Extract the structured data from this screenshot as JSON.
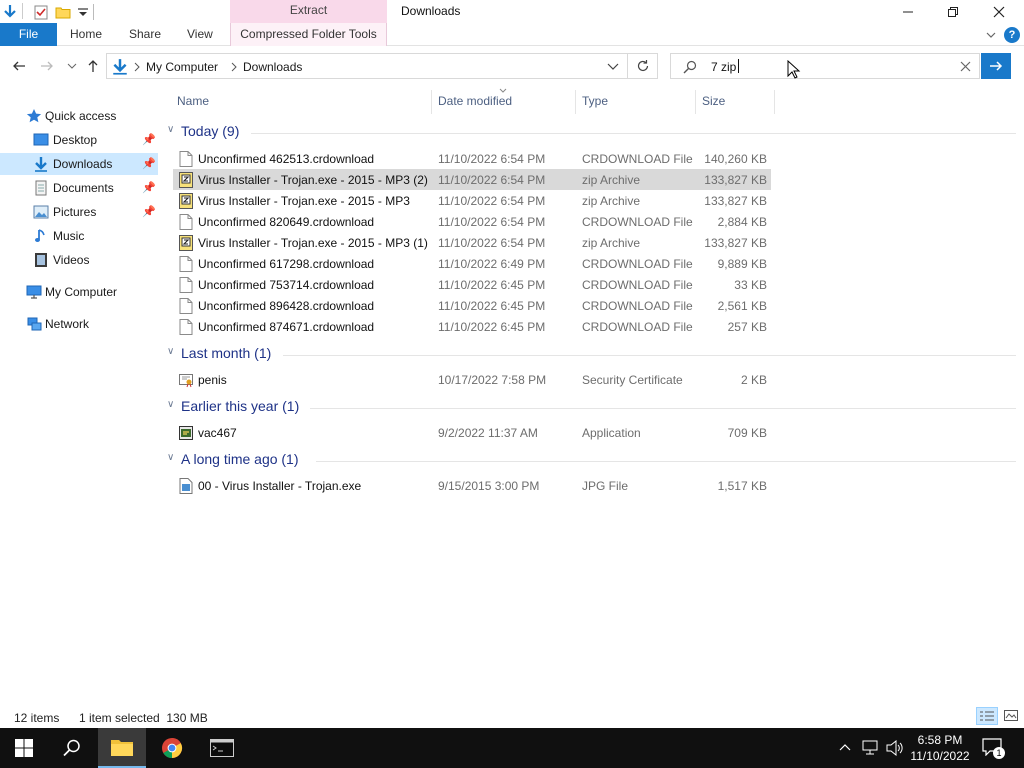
{
  "window": {
    "title": "Downloads",
    "contextual_group": "Extract"
  },
  "ribbon": {
    "tabs": [
      "File",
      "Home",
      "Share",
      "View",
      "Compressed Folder Tools"
    ]
  },
  "address": {
    "breadcrumb": [
      "My Computer",
      "Downloads"
    ]
  },
  "search": {
    "value": "7 zip"
  },
  "nav_pane": {
    "items": [
      {
        "label": "Quick access",
        "icon": "star-icon"
      },
      {
        "label": "Desktop",
        "icon": "desktop-icon"
      },
      {
        "label": "Downloads",
        "icon": "download-arrow-icon"
      },
      {
        "label": "Documents",
        "icon": "documents-icon"
      },
      {
        "label": "Pictures",
        "icon": "pictures-icon"
      },
      {
        "label": "Music",
        "icon": "music-note-icon"
      },
      {
        "label": "Videos",
        "icon": "video-icon"
      },
      {
        "label": "My Computer",
        "icon": "computer-icon"
      },
      {
        "label": "Network",
        "icon": "network-icon"
      }
    ]
  },
  "columns": {
    "name": "Name",
    "date": "Date modified",
    "type": "Type",
    "size": "Size"
  },
  "groups": [
    {
      "title": "Today (9)",
      "files": [
        {
          "name": "Unconfirmed 462513.crdownload",
          "date": "11/10/2022 6:54 PM",
          "type": "CRDOWNLOAD File",
          "size": "140,260 KB",
          "icon": "blank-file-icon"
        },
        {
          "name": "Virus Installer - Trojan.exe - 2015 - MP3 (2)",
          "date": "11/10/2022 6:54 PM",
          "type": "zip Archive",
          "size": "133,827 KB",
          "icon": "zip-archive-icon"
        },
        {
          "name": "Virus Installer - Trojan.exe - 2015 - MP3",
          "date": "11/10/2022 6:54 PM",
          "type": "zip Archive",
          "size": "133,827 KB",
          "icon": "zip-archive-icon"
        },
        {
          "name": "Unconfirmed 820649.crdownload",
          "date": "11/10/2022 6:54 PM",
          "type": "CRDOWNLOAD File",
          "size": "2,884 KB",
          "icon": "blank-file-icon"
        },
        {
          "name": "Virus Installer - Trojan.exe - 2015 - MP3 (1)",
          "date": "11/10/2022 6:54 PM",
          "type": "zip Archive",
          "size": "133,827 KB",
          "icon": "zip-archive-icon"
        },
        {
          "name": "Unconfirmed 617298.crdownload",
          "date": "11/10/2022 6:49 PM",
          "type": "CRDOWNLOAD File",
          "size": "9,889 KB",
          "icon": "blank-file-icon"
        },
        {
          "name": "Unconfirmed 753714.crdownload",
          "date": "11/10/2022 6:45 PM",
          "type": "CRDOWNLOAD File",
          "size": "33 KB",
          "icon": "blank-file-icon"
        },
        {
          "name": "Unconfirmed 896428.crdownload",
          "date": "11/10/2022 6:45 PM",
          "type": "CRDOWNLOAD File",
          "size": "2,561 KB",
          "icon": "blank-file-icon"
        },
        {
          "name": "Unconfirmed 874671.crdownload",
          "date": "11/10/2022 6:45 PM",
          "type": "CRDOWNLOAD File",
          "size": "257 KB",
          "icon": "blank-file-icon"
        }
      ]
    },
    {
      "title": "Last month (1)",
      "files": [
        {
          "name": "penis",
          "date": "10/17/2022 7:58 PM",
          "type": "Security Certificate",
          "size": "2 KB",
          "icon": "certificate-icon"
        }
      ]
    },
    {
      "title": "Earlier this year (1)",
      "files": [
        {
          "name": "vac467",
          "date": "9/2/2022 11:37 AM",
          "type": "Application",
          "size": "709 KB",
          "icon": "application-icon"
        }
      ]
    },
    {
      "title": "A long time ago (1)",
      "files": [
        {
          "name": "00 - Virus Installer - Trojan.exe",
          "date": "9/15/2015 3:00 PM",
          "type": "JPG File",
          "size": "1,517 KB",
          "icon": "image-file-icon"
        }
      ]
    }
  ],
  "status": {
    "count": "12 items",
    "selection": "1 item selected  130 MB"
  },
  "taskbar": {
    "time": "6:58 PM",
    "date": "11/10/2022",
    "notification_count": "1"
  },
  "colors": {
    "accent": "#1979ca",
    "selection": "#cce8ff",
    "row_selected": "#d9d9d9",
    "group_title": "#1e3287",
    "taskbar": "#101010"
  }
}
